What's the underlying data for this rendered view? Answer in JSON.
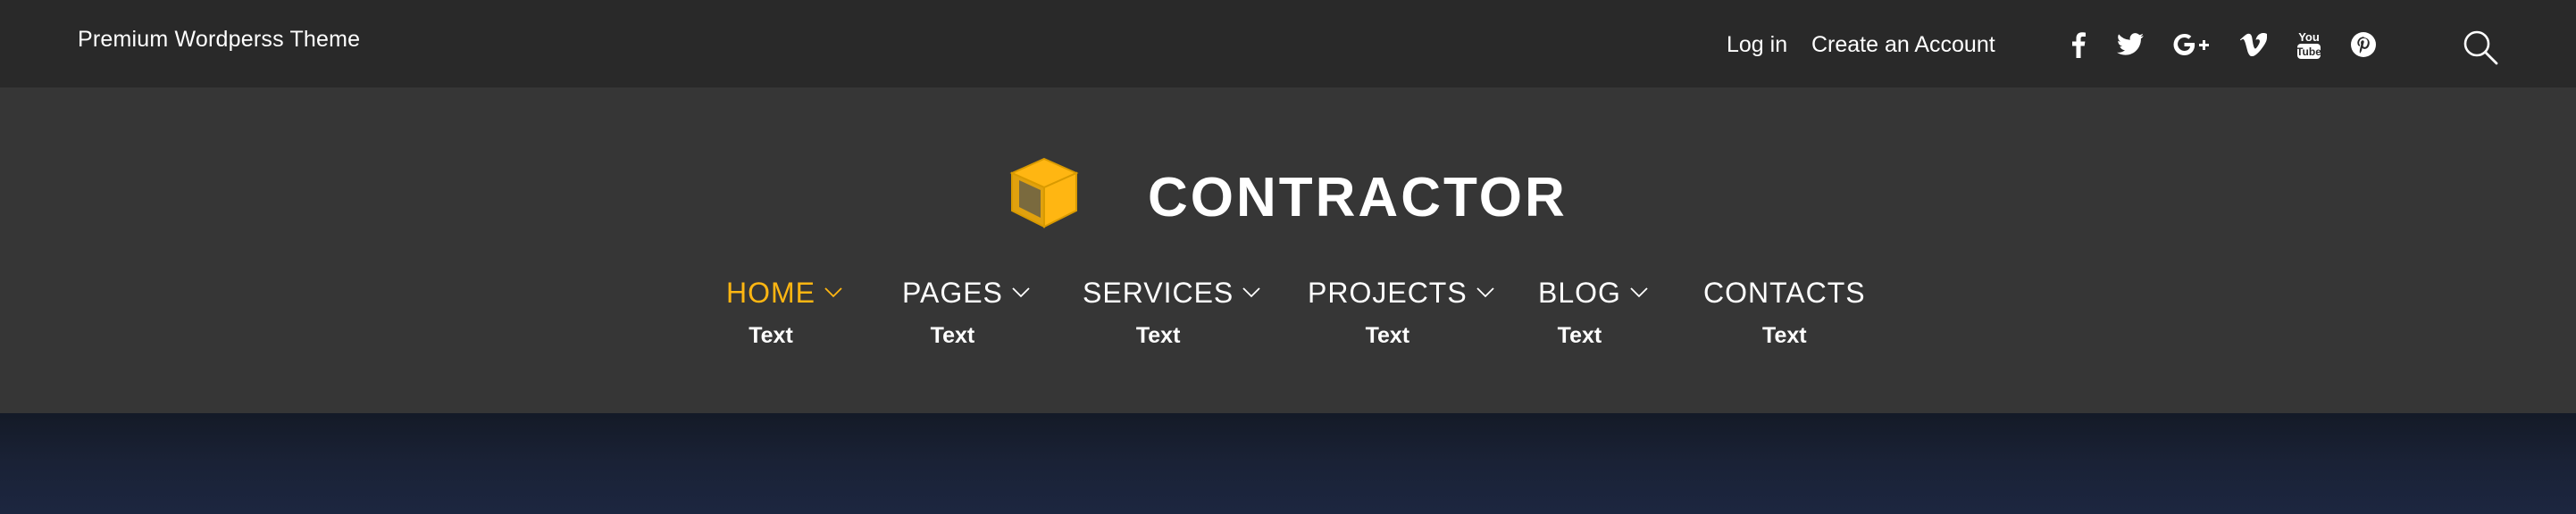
{
  "topbar": {
    "tagline": "Premium Wordperss Theme",
    "login": "Log in",
    "create_account": "Create an Account",
    "social": [
      "facebook-icon",
      "twitter-icon",
      "google-plus-icon",
      "vimeo-icon",
      "youtube-icon",
      "pinterest-icon"
    ],
    "youtube_text": "You",
    "youtube_text2": "Tube"
  },
  "header": {
    "brand": "CONTRACTOR",
    "logo_color": "#ffb612",
    "nav": [
      {
        "label": "HOME",
        "sub": "Text",
        "active": true,
        "dropdown": true
      },
      {
        "label": "PAGES",
        "sub": "Text",
        "active": false,
        "dropdown": true
      },
      {
        "label": "SERVICES",
        "sub": "Text",
        "active": false,
        "dropdown": true
      },
      {
        "label": "PROJECTS",
        "sub": "Text",
        "active": false,
        "dropdown": true
      },
      {
        "label": "BLOG",
        "sub": "Text",
        "active": false,
        "dropdown": true
      },
      {
        "label": "CONTACTS",
        "sub": "Text",
        "active": false,
        "dropdown": false
      }
    ]
  },
  "colors": {
    "topbar_bg": "#292929",
    "header_bg": "#363636",
    "accent": "#ffb612",
    "hero_bg": "#1b2233"
  }
}
